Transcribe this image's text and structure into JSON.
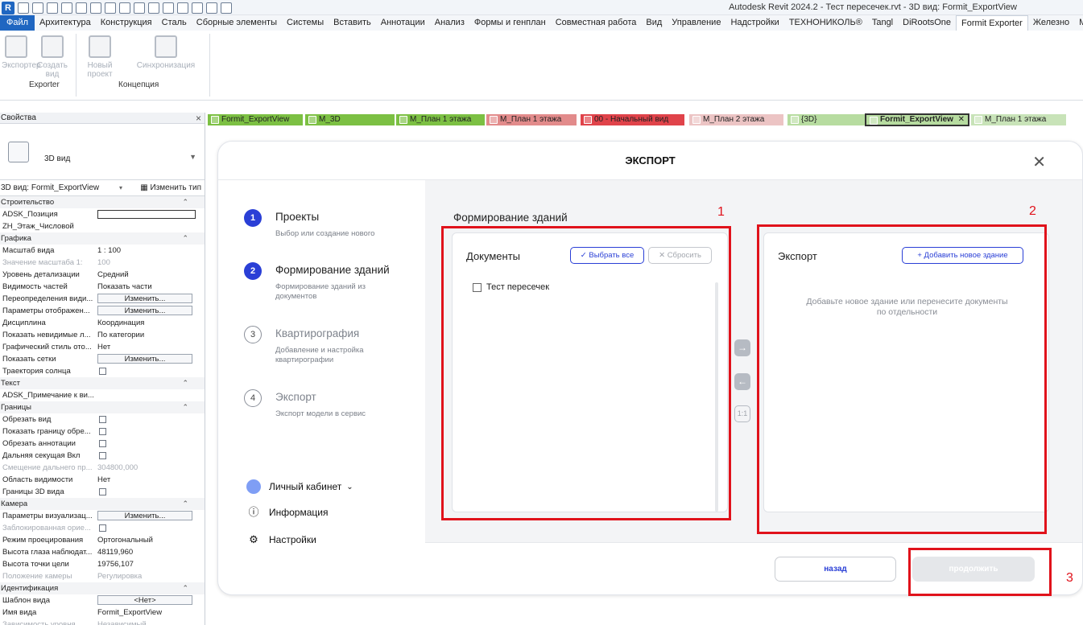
{
  "app": {
    "title": "Autodesk Revit 2024.2 - Тест пересечек.rvt - 3D вид: Formit_ExportView",
    "logo": "R"
  },
  "menu": [
    "Файл",
    "Архитектура",
    "Конструкция",
    "Сталь",
    "Сборные элементы",
    "Системы",
    "Вставить",
    "Аннотации",
    "Анализ",
    "Формы и генплан",
    "Совместная работа",
    "Вид",
    "Управление",
    "Надстройки",
    "ТЕХНОНИКОЛЬ®",
    "Tangl",
    "DiRootsOne",
    "Formit Exporter",
    "Железно",
    "ModPlus"
  ],
  "ribbon": {
    "buttons": [
      "Экспортер",
      "Создать вид",
      "Новый проект",
      "Синхронизация"
    ],
    "groups": [
      "Exporter",
      "Концепция"
    ]
  },
  "properties": {
    "header": "Свойства",
    "type_name": "3D вид",
    "view_selector": "3D вид: Formit_ExportView",
    "edit_type": "Изменить тип",
    "rows": [
      {
        "kind": "sec",
        "name": "Строительство"
      },
      {
        "kind": "txt",
        "name": "ADSK_Позиция",
        "value": ""
      },
      {
        "kind": "plain",
        "name": "ZH_Этаж_Числовой",
        "value": ""
      },
      {
        "kind": "sec",
        "name": "Графика"
      },
      {
        "kind": "plain",
        "name": "Масштаб вида",
        "value": "1 : 100"
      },
      {
        "kind": "dim",
        "name": "Значение масштаба   1:",
        "value": "100"
      },
      {
        "kind": "plain",
        "name": "Уровень детализации",
        "value": "Средний"
      },
      {
        "kind": "plain",
        "name": "Видимость частей",
        "value": "Показать части"
      },
      {
        "kind": "btn",
        "name": "Переопределения види...",
        "value": "Изменить..."
      },
      {
        "kind": "btn",
        "name": "Параметры отображен...",
        "value": "Изменить..."
      },
      {
        "kind": "plain",
        "name": "Дисциплина",
        "value": "Координация"
      },
      {
        "kind": "plain",
        "name": "Показать невидимые л...",
        "value": "По категории"
      },
      {
        "kind": "plain",
        "name": "Графический стиль ото...",
        "value": "Нет"
      },
      {
        "kind": "btn",
        "name": "Показать сетки",
        "value": "Изменить..."
      },
      {
        "kind": "chk",
        "name": "Траектория солнца",
        "value": ""
      },
      {
        "kind": "sec",
        "name": "Текст"
      },
      {
        "kind": "plain",
        "name": "ADSK_Примечание к ви...",
        "value": ""
      },
      {
        "kind": "sec",
        "name": "Границы"
      },
      {
        "kind": "chk",
        "name": "Обрезать вид",
        "value": ""
      },
      {
        "kind": "chk",
        "name": "Показать границу обре...",
        "value": ""
      },
      {
        "kind": "chk",
        "name": "Обрезать аннотации",
        "value": ""
      },
      {
        "kind": "chk",
        "name": "Дальняя секущая Вкл",
        "value": ""
      },
      {
        "kind": "dim",
        "name": "Смещение дальнего пр...",
        "value": "304800,000"
      },
      {
        "kind": "plain",
        "name": "Область видимости",
        "value": "Нет"
      },
      {
        "kind": "chk",
        "name": "Границы 3D вида",
        "value": ""
      },
      {
        "kind": "sec",
        "name": "Камера"
      },
      {
        "kind": "btn",
        "name": "Параметры визуализац...",
        "value": "Изменить..."
      },
      {
        "kind": "dimchk",
        "name": "Заблокированная орие...",
        "value": ""
      },
      {
        "kind": "plain",
        "name": "Режим проецирования",
        "value": "Ортогональный"
      },
      {
        "kind": "plain",
        "name": "Высота глаза наблюдат...",
        "value": "48119,960"
      },
      {
        "kind": "plain",
        "name": "Высота точки цели",
        "value": "19756,107"
      },
      {
        "kind": "dim",
        "name": "Положение камеры",
        "value": "Регулировка"
      },
      {
        "kind": "sec",
        "name": "Идентификация"
      },
      {
        "kind": "btn",
        "name": "Шаблон вида",
        "value": "<Нет>"
      },
      {
        "kind": "plain",
        "name": "Имя вида",
        "value": "Formit_ExportView"
      },
      {
        "kind": "dim",
        "name": "Зависимость уровня",
        "value": "Независимый"
      }
    ]
  },
  "tabs": [
    {
      "label": "Formit_ExportView",
      "color": "#7cc043"
    },
    {
      "label": "M_3D",
      "color": "#7cc043"
    },
    {
      "label": "М_План 1 этажа",
      "color": "#7cc043"
    },
    {
      "label": "М_План 1 этажа",
      "color": "#e28b8b"
    },
    {
      "label": "00 - Начальный вид",
      "color": "#e0434a"
    },
    {
      "label": "М_План 2 этажа",
      "color": "#ecc4c4"
    },
    {
      "label": "{3D}",
      "color": "#b7dca0"
    },
    {
      "label": "Formit_ExportView",
      "color": "#b7dca0",
      "active": true
    },
    {
      "label": "М_План 1 этажа",
      "color": "#c8e3b8"
    }
  ],
  "dialog": {
    "title": "ЭКСПОРТ",
    "steps": [
      {
        "num": "1",
        "title": "Проекты",
        "desc": "Выбор или создание нового",
        "on": true
      },
      {
        "num": "2",
        "title": "Формирование зданий",
        "desc": "Формирование зданий из документов",
        "on": true
      },
      {
        "num": "3",
        "title": "Квартирография",
        "desc": "Добавление и настройка квартирографии",
        "on": false
      },
      {
        "num": "4",
        "title": "Экспорт",
        "desc": "Экспорт модели в сервис",
        "on": false
      }
    ],
    "links": {
      "account": "Личный кабинет",
      "info": "Информация",
      "settings": "Настройки"
    },
    "panel_title": "Формирование зданий",
    "documents": {
      "title": "Документы",
      "select_all": "Выбрать все",
      "reset": "Сбросить",
      "items": [
        "Тест пересечек"
      ]
    },
    "export": {
      "title": "Экспорт",
      "add_building": "Добавить новое здание",
      "hint": "Добавьте новое здание или перенесите документы по отдельности"
    },
    "transfer": {
      "one_to_one": "1:1"
    },
    "back": "назад",
    "next": "продолжить"
  },
  "annotations": [
    "1",
    "2",
    "3"
  ],
  "colors": {
    "accent": "#2a3fd6",
    "annotation_red": "#e0121b",
    "revit_blue": "#1f66c1"
  }
}
